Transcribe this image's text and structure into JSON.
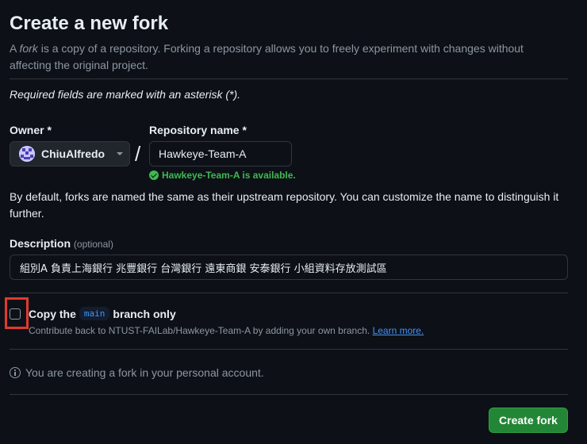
{
  "header": {
    "title": "Create a new fork",
    "subtitle_prefix": "A ",
    "subtitle_emphasis": "fork",
    "subtitle_rest": " is a copy of a repository. Forking a repository allows you to freely experiment with changes without affecting the original project."
  },
  "form": {
    "required_note": "Required fields are marked with an asterisk (*).",
    "owner": {
      "label": "Owner *",
      "selected": "ChiuAlfredo"
    },
    "separator": "/",
    "repository": {
      "label": "Repository name *",
      "value": "Hawkeye-Team-A",
      "availability": "Hawkeye-Team-A is available."
    },
    "default_note": "By default, forks are named the same as their upstream repository. You can customize the name to distinguish it further.",
    "description": {
      "label": "Description",
      "optional": "(optional)",
      "value": "組別A 負責上海銀行 兆豐銀行 台灣銀行 遠東商銀 安泰銀行 小組資料存放測試區"
    },
    "copy_branch": {
      "label_prefix": "Copy the",
      "branch": "main",
      "label_suffix": "branch only",
      "checked": false,
      "help_text": "Contribute back to NTUST-FAILab/Hawkeye-Team-A by adding your own branch.",
      "learn_more": "Learn more."
    },
    "info": "You are creating a fork in your personal account.",
    "submit_label": "Create fork"
  },
  "colors": {
    "background": "#0d1117",
    "border": "#30363d",
    "text": "#e6edf3",
    "muted": "#8d96a0",
    "success": "#3fb950",
    "link": "#4493f8",
    "primary_button": "#238636",
    "highlight": "#e03a2f"
  },
  "icons": [
    "avatar",
    "chevron-down-icon",
    "check-circle-icon",
    "info-icon"
  ]
}
